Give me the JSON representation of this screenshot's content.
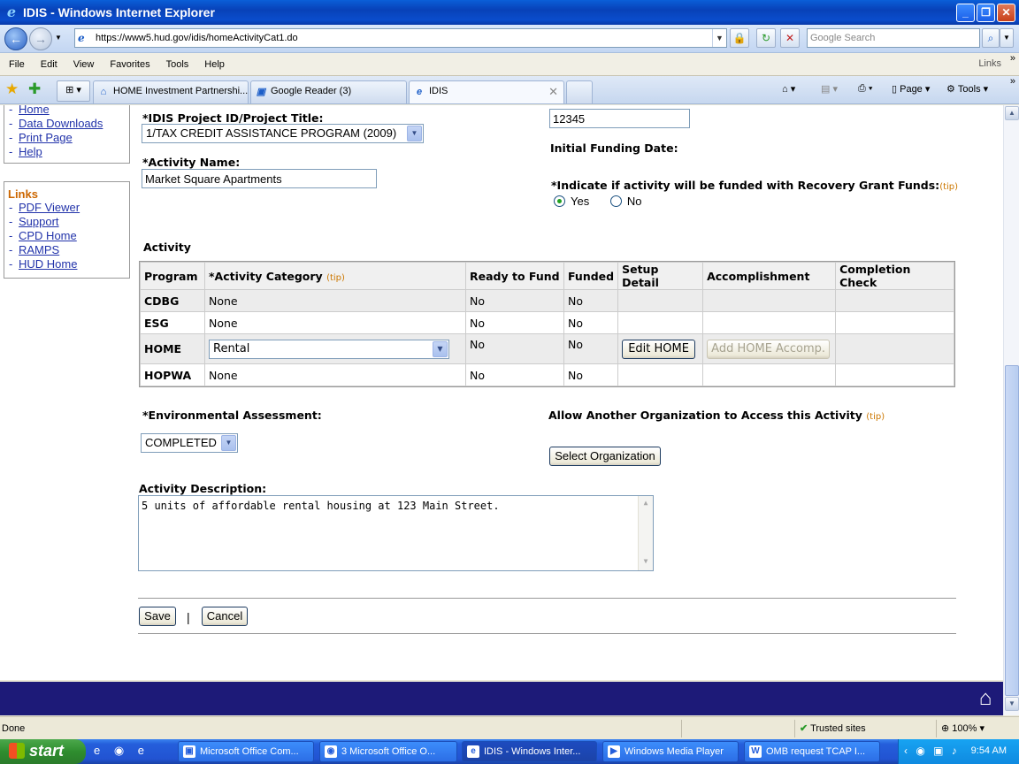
{
  "window": {
    "title": "IDIS - Windows Internet Explorer"
  },
  "address_bar": {
    "url": "https://www5.hud.gov/idis/homeActivityCat1.do",
    "search_placeholder": "Google Search"
  },
  "menu": {
    "items": [
      "File",
      "Edit",
      "View",
      "Favorites",
      "Tools",
      "Help"
    ],
    "links_label": "Links"
  },
  "tabs": [
    {
      "label": "HOME Investment Partnershi..."
    },
    {
      "label": "Google Reader (3)"
    },
    {
      "label": "IDIS"
    }
  ],
  "command_bar": {
    "page_label": "Page",
    "tools_label": "Tools"
  },
  "sidebar": {
    "nav_items": [
      "Home",
      "Data Downloads",
      "Print Page",
      "Help"
    ],
    "links_heading": "Links",
    "links": [
      "PDF Viewer",
      "Support",
      "CPD Home",
      "RAMPS",
      "HUD Home"
    ]
  },
  "form": {
    "project_label": "*IDIS Project ID/Project Title:",
    "project_value": "1/TAX CREDIT ASSISTANCE PROGRAM  (2009)",
    "id_value": "12345",
    "initial_funding_label": "Initial Funding Date:",
    "activity_name_label": "*Activity Name:",
    "activity_name_value": "Market Square Apartments",
    "recovery_label": "*Indicate if activity will be funded with Recovery Grant Funds:",
    "tip": "(tip)",
    "radio_yes": "Yes",
    "radio_no": "No",
    "recovery_selected": "Yes",
    "activity_heading": "Activity",
    "env_label": "*Environmental Assessment:",
    "env_value": "COMPLETED",
    "allow_label": "Allow Another Organization to Access this Activity",
    "select_org_button": "Select Organization",
    "description_label": "Activity Description:",
    "description_value": "5 units of affordable rental housing at 123 Main Street.",
    "save_button": "Save",
    "separator": "|",
    "cancel_button": "Cancel"
  },
  "activity_table": {
    "headers": [
      "Program",
      "*Activity Category",
      "Ready to Fund",
      "Funded",
      "Setup Detail",
      "Accomplishment",
      "Completion Check"
    ],
    "rows": [
      {
        "program": "CDBG",
        "category": "None",
        "ready": "No",
        "funded": "No"
      },
      {
        "program": "ESG",
        "category": "None",
        "ready": "No",
        "funded": "No"
      },
      {
        "program": "HOME",
        "category": "Rental",
        "ready": "No",
        "funded": "No",
        "setup_button": "Edit HOME",
        "accomp_button": "Add HOME Accomp."
      },
      {
        "program": "HOPWA",
        "category": "None",
        "ready": "No",
        "funded": "No"
      }
    ]
  },
  "status_bar": {
    "status": "Done",
    "zone": "Trusted sites",
    "zoom": "100%"
  },
  "taskbar": {
    "start": "start",
    "tasks": [
      "Microsoft Office Com...",
      "3 Microsoft Office O...",
      "IDIS - Windows Inter...",
      "Windows Media Player",
      "OMB request TCAP I..."
    ],
    "clock": "9:54 AM"
  }
}
